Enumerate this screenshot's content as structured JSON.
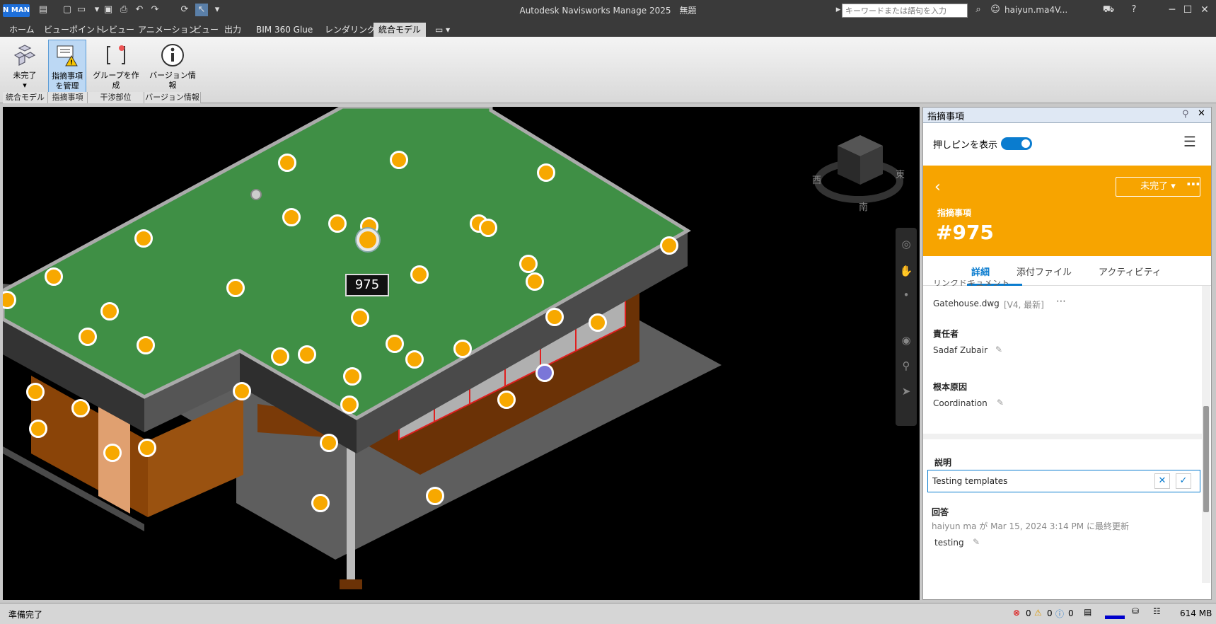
{
  "titlebar": {
    "app_title": "Autodesk Navisworks Manage 2025　無題",
    "logo": "N MAN",
    "search_placeholder": "キーワードまたは語句を入力",
    "user": "haiyun.ma4V..."
  },
  "menu": [
    "ホーム",
    "ビューポイント",
    "レビュー",
    "アニメーション",
    "ビュー",
    "出力",
    "BIM 360 Glue",
    "レンダリング",
    "統合モデル"
  ],
  "menu_active_index": 8,
  "ribbon": {
    "buttons": [
      {
        "label1": "未完了",
        "label2": "▾"
      },
      {
        "label1": "指摘事項",
        "label2": "を管理"
      },
      {
        "label1": "グループを作成",
        "label2": ""
      },
      {
        "label1": "バージョン情報",
        "label2": ""
      }
    ],
    "groups": [
      "統合モデル",
      "指摘事項",
      "干渉部位",
      "バージョン情報"
    ]
  },
  "viewport": {
    "pin_label": "975",
    "compass": {
      "west": "西",
      "east": "東",
      "south": "南"
    }
  },
  "panel": {
    "title": "指摘事項",
    "show_pins_label": "押しピンを表示",
    "status_button": "未完了 ▾",
    "issue_type": "指摘事項",
    "issue_number": "#975",
    "tabs": [
      "詳細",
      "添付ファイル",
      "アクティビティ"
    ],
    "partial_heading": "リンクドキュメント",
    "file_name": "Gatehouse.dwg",
    "file_version": "[V4, 最新]",
    "assignee_label": "責任者",
    "assignee": "Sadaf Zubair",
    "root_cause_label": "根本原因",
    "root_cause": "Coordination",
    "description_label": "説明",
    "description_value": "Testing templates",
    "answer_label": "回答",
    "answer_meta": "haiyun ma が Mar 15, 2024 3:14 PM に最終更新",
    "answer_value": "testing"
  },
  "statusbar": {
    "ready": "準備完了",
    "errors": "0",
    "warnings": "0",
    "infos": "0",
    "memory": "614 MB"
  },
  "colors": {
    "accent": "#0a7ccf",
    "issue_orange": "#f7a400",
    "pin": "#f7a800",
    "roof": "#3f8f45"
  }
}
